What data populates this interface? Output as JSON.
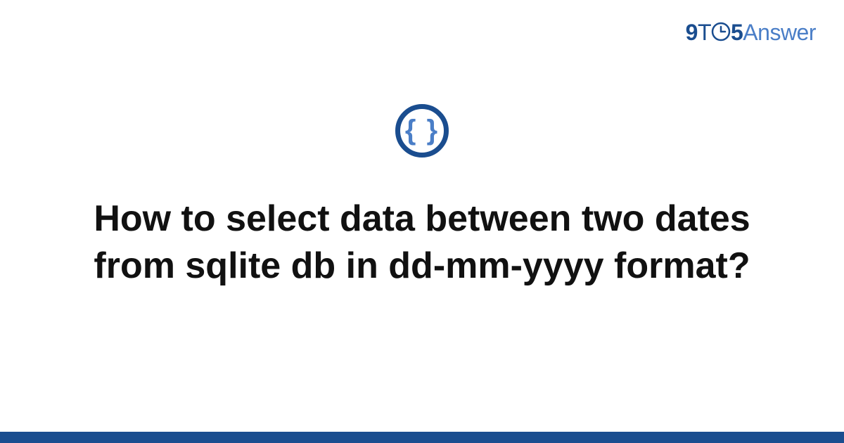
{
  "brand": {
    "nine": "9",
    "t": "T",
    "five": "5",
    "answer": "Answer"
  },
  "icon": {
    "braces": "{ }"
  },
  "title": "How to select data between two dates from sqlite db in dd-mm-yyyy format?",
  "colors": {
    "brand_dark": "#1a4d8f",
    "brand_light": "#4a7ec7"
  }
}
